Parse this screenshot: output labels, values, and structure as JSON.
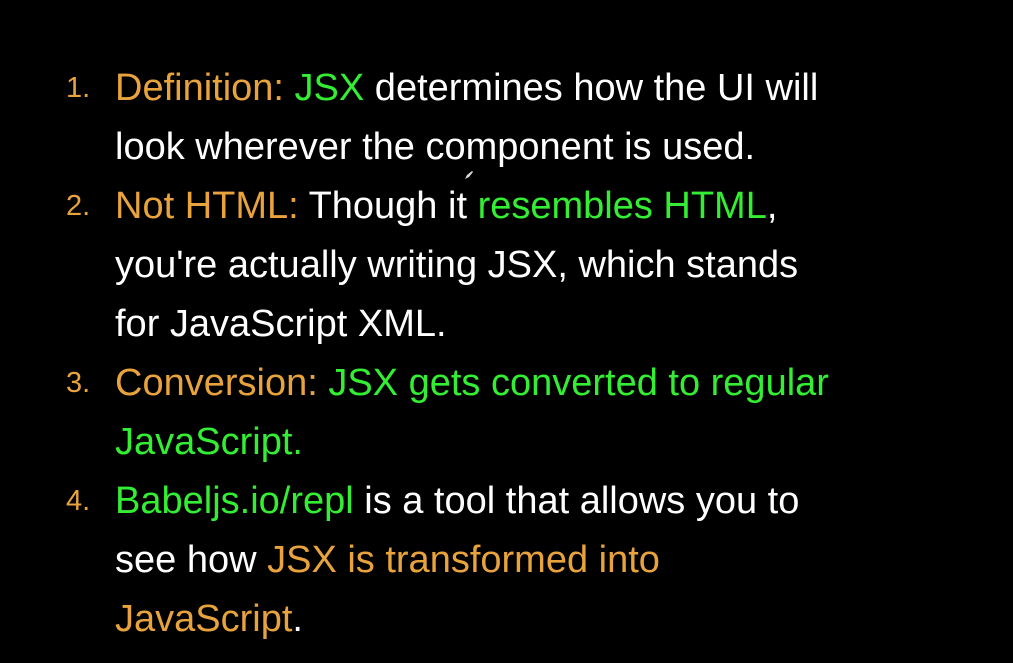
{
  "colors": {
    "background": "#000000",
    "orange": "#E8A33D",
    "green": "#33EE33",
    "white": "#FFFFFF"
  },
  "items": [
    {
      "number": "1.",
      "lines": [
        [
          {
            "text": "Definition: ",
            "color": "orange"
          },
          {
            "text": "JSX",
            "color": "green"
          },
          {
            "text": " determines how the UI will",
            "color": "white"
          }
        ],
        [
          {
            "text": "look wherever the component is used.",
            "color": "white"
          }
        ]
      ]
    },
    {
      "number": "2.",
      "lines": [
        [
          {
            "text": "Not HTML: ",
            "color": "orange"
          },
          {
            "text": "Though it ",
            "color": "white"
          },
          {
            "text": "resembles HTML",
            "color": "green"
          },
          {
            "text": ",",
            "color": "white"
          }
        ],
        [
          {
            "text": "you're actually writing JSX, which stands",
            "color": "white"
          }
        ],
        [
          {
            "text": "for JavaScript XML.",
            "color": "white"
          }
        ]
      ]
    },
    {
      "number": "3.",
      "lines": [
        [
          {
            "text": "Conversion: ",
            "color": "orange"
          },
          {
            "text": "JSX gets converted to regular",
            "color": "green"
          }
        ],
        [
          {
            "text": "JavaScript.",
            "color": "green"
          }
        ]
      ]
    },
    {
      "number": "4.",
      "lines": [
        [
          {
            "text": "Babeljs.io/repl",
            "color": "green"
          },
          {
            "text": " is a tool that allows you to",
            "color": "white"
          }
        ],
        [
          {
            "text": "see how ",
            "color": "white"
          },
          {
            "text": "JSX is transformed into",
            "color": "orange"
          }
        ],
        [
          {
            "text": "JavaScript",
            "color": "orange"
          },
          {
            "text": ".",
            "color": "white"
          }
        ]
      ]
    }
  ],
  "cursor": {
    "icon": "pen-cursor-icon"
  }
}
